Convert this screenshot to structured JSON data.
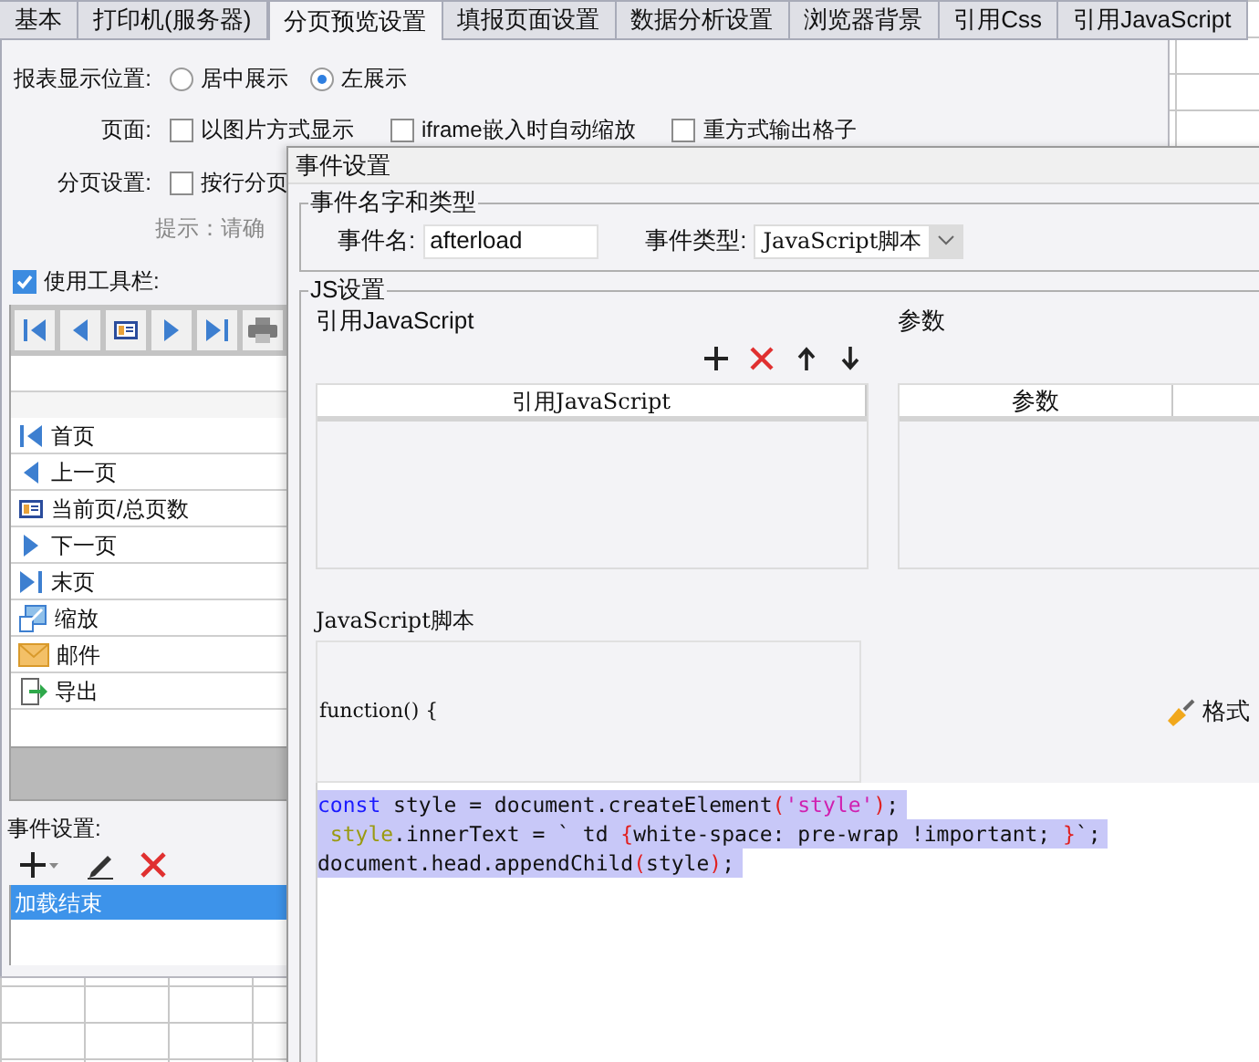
{
  "tabs": [
    {
      "label": "基本",
      "selected": false
    },
    {
      "label": "打印机(服务器)",
      "selected": false
    },
    {
      "label": "分页预览设置",
      "selected": true
    },
    {
      "label": "填报页面设置",
      "selected": false
    },
    {
      "label": "数据分析设置",
      "selected": false
    },
    {
      "label": "浏览器背景",
      "selected": false
    },
    {
      "label": "引用Css",
      "selected": false
    },
    {
      "label": "引用JavaScript",
      "selected": false
    }
  ],
  "display_position": {
    "label": "报表显示位置:",
    "options": [
      {
        "label": "居中展示",
        "selected": false
      },
      {
        "label": "左展示",
        "selected": true
      }
    ]
  },
  "page": {
    "label": "页面:",
    "options": [
      {
        "label": "以图片方式显示",
        "checked": false
      },
      {
        "label": "iframe嵌入时自动缩放",
        "checked": false
      },
      {
        "label": "重方式输出格子",
        "checked": false
      }
    ]
  },
  "pagination": {
    "label": "分页设置:",
    "options": [
      {
        "label": "按行分页",
        "checked": false
      }
    ]
  },
  "hint": "提示：请确",
  "use_toolbar": {
    "label": "使用工具栏:",
    "checked": true
  },
  "toolbar_items": [
    {
      "label": "首页",
      "kind": "first"
    },
    {
      "label": "上一页",
      "kind": "prev"
    },
    {
      "label": "当前页/总页数",
      "kind": "page"
    },
    {
      "label": "下一页",
      "kind": "next"
    },
    {
      "label": "末页",
      "kind": "last"
    },
    {
      "label": "缩放",
      "kind": "zoom"
    },
    {
      "label": "邮件",
      "kind": "mail"
    },
    {
      "label": "导出",
      "kind": "export"
    }
  ],
  "events": {
    "label": "事件设置:",
    "items": [
      {
        "label": "加载结束",
        "selected": true
      }
    ]
  },
  "dialog": {
    "title": "事件设置",
    "name_group": {
      "title": "事件名字和类型",
      "name_label": "事件名:",
      "name_value": "afterload",
      "type_label": "事件类型:",
      "type_value": "JavaScript脚本"
    },
    "js_group": {
      "title": "JS设置",
      "refs": {
        "title": "引用JavaScript",
        "columns": [
          "引用JavaScript"
        ]
      },
      "params": {
        "title": "参数",
        "columns": [
          "参数"
        ]
      },
      "script": {
        "title": "JavaScript脚本",
        "header": "function() {",
        "format_button": "格式",
        "code": [
          {
            "selected": true,
            "tokens": [
              {
                "kind": "keyword",
                "text": "const"
              },
              {
                "kind": "plain",
                "text": " style = document.createElement"
              },
              {
                "kind": "punct",
                "text": "("
              },
              {
                "kind": "string",
                "text": "'style'"
              },
              {
                "kind": "punct",
                "text": ")"
              },
              {
                "kind": "plain",
                "text": ";"
              }
            ]
          },
          {
            "selected": true,
            "tokens": [
              {
                "kind": "variable",
                "text": " style"
              },
              {
                "kind": "plain",
                "text": ".innerText = ` td "
              },
              {
                "kind": "punct",
                "text": "{"
              },
              {
                "kind": "plain",
                "text": "white-space: pre-wrap !important; "
              },
              {
                "kind": "punct",
                "text": "}"
              },
              {
                "kind": "plain",
                "text": "`;"
              }
            ]
          },
          {
            "selected": true,
            "tokens": [
              {
                "kind": "plain",
                "text": "document.head.appendChild"
              },
              {
                "kind": "punct",
                "text": "("
              },
              {
                "kind": "plain",
                "text": "style"
              },
              {
                "kind": "punct",
                "text": ")"
              },
              {
                "kind": "plain",
                "text": ";"
              }
            ]
          }
        ]
      }
    }
  }
}
